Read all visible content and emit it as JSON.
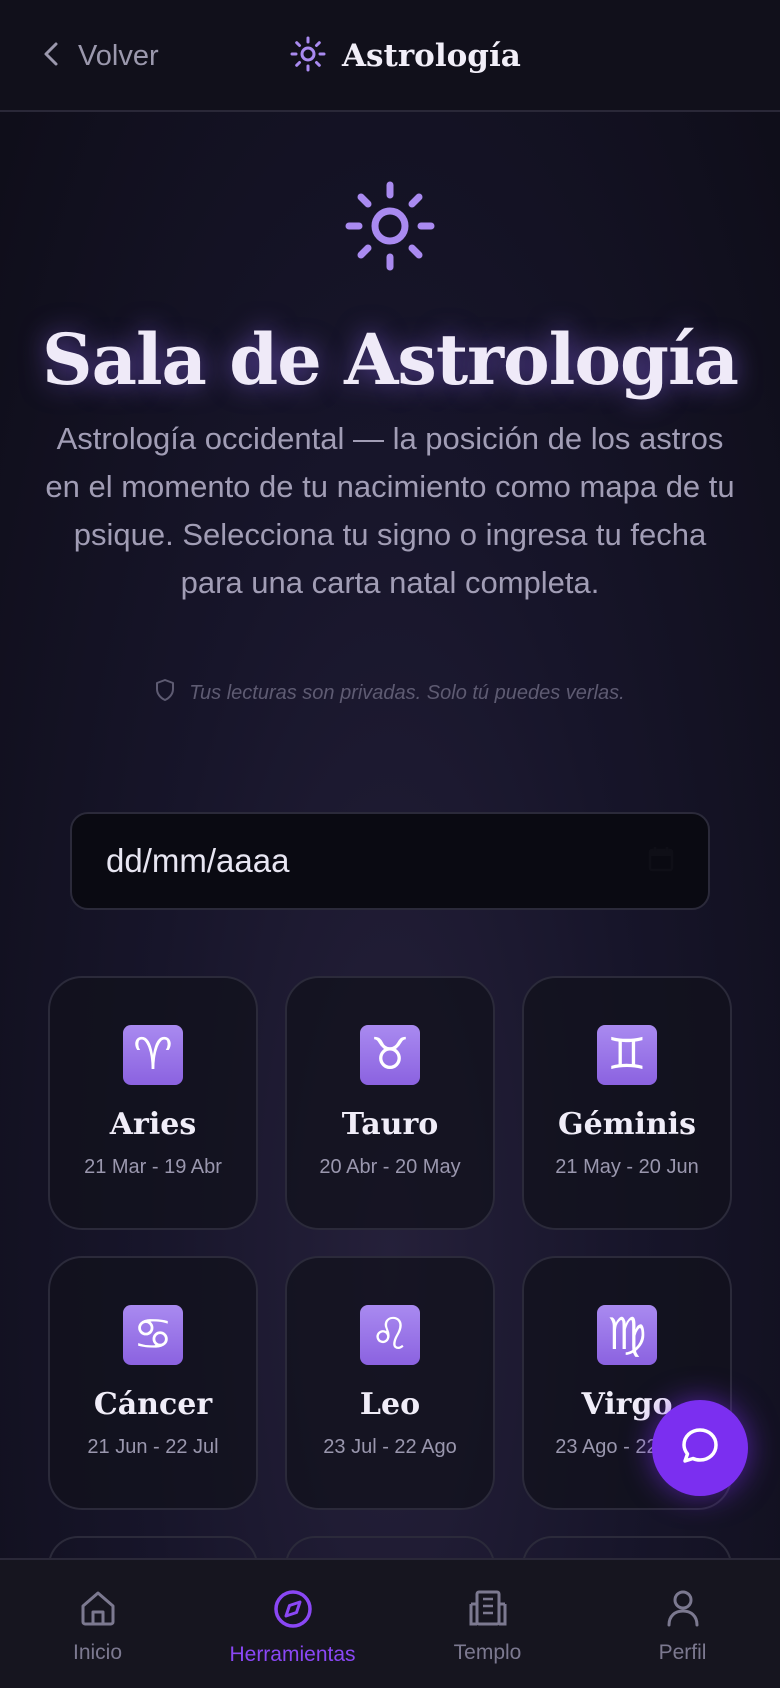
{
  "header": {
    "back_label": "Volver",
    "title": "Astrología"
  },
  "hero": {
    "icon": "sun-icon",
    "title": "Sala de Astrología",
    "description": "Astrología occidental — la posición de los astros en el momento de tu nacimiento como mapa de tu psique. Selecciona tu signo o ingresa tu fecha para una carta natal completa.",
    "privacy_note": "Tus lecturas son privadas. Solo tú puedes verlas."
  },
  "date_input": {
    "placeholder": "dd/mm/aaaa"
  },
  "signs": [
    {
      "symbol": "♈",
      "name": "Aries",
      "dates": "21 Mar - 19 Abr"
    },
    {
      "symbol": "♉",
      "name": "Tauro",
      "dates": "20 Abr - 20 May"
    },
    {
      "symbol": "♊",
      "name": "Géminis",
      "dates": "21 May - 20 Jun"
    },
    {
      "symbol": "♋",
      "name": "Cáncer",
      "dates": "21 Jun - 22 Jul"
    },
    {
      "symbol": "♌",
      "name": "Leo",
      "dates": "23 Jul - 22 Ago"
    },
    {
      "symbol": "♍",
      "name": "Virgo",
      "dates": "23 Ago - 22 Sep"
    }
  ],
  "bottom_nav": [
    {
      "label": "Inicio",
      "icon": "home-icon",
      "active": false
    },
    {
      "label": "Herramientas",
      "icon": "compass-icon",
      "active": true
    },
    {
      "label": "Templo",
      "icon": "building-icon",
      "active": false
    },
    {
      "label": "Perfil",
      "icon": "user-icon",
      "active": false
    }
  ],
  "colors": {
    "accent": "#7b2ff0",
    "sun_icon": "#a98af0",
    "background": "#17152a"
  }
}
